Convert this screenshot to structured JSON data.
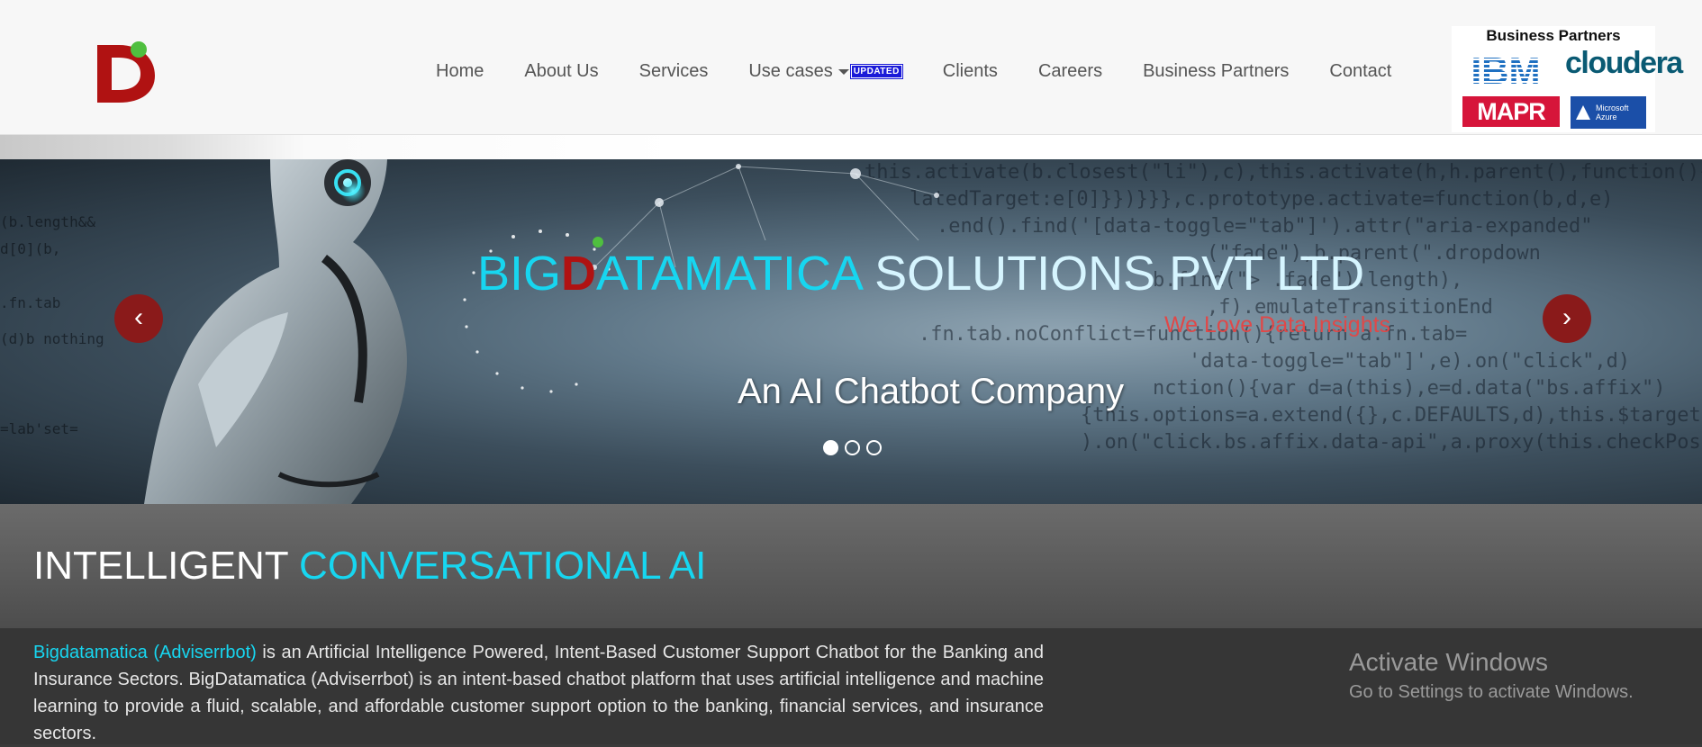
{
  "nav": {
    "items": [
      {
        "label": "Home"
      },
      {
        "label": "About Us"
      },
      {
        "label": "Services"
      },
      {
        "label": "Use cases",
        "badge": "UPDATED"
      },
      {
        "label": "Clients"
      },
      {
        "label": "Careers"
      },
      {
        "label": "Business Partners"
      },
      {
        "label": "Contact"
      }
    ]
  },
  "partners": {
    "title": "Business Partners",
    "logos": {
      "ibm": "IBM",
      "cloudera": "cloudera",
      "mapr": "MAPR",
      "azure_line1": "Microsoft",
      "azure_line2": "Azure"
    }
  },
  "hero": {
    "title_part1": "BIG",
    "title_d": "D",
    "title_part2": "ATAMATICA",
    "title_part3": " SOLUTIONS PVT LTD",
    "tagline": "We Love Data Insights",
    "subtitle": "An AI Chatbot Company",
    "prev_label": "‹",
    "next_label": "›",
    "slide_count": 3,
    "active_slide": 1
  },
  "intro": {
    "title_white": "INTELLIGENT ",
    "title_cyan": "CONVERSATIONAL AI",
    "para_highlight": "Bigdatamatica (Adviserrbot)",
    "para_rest": " is an Artificial Intelligence Powered, Intent-Based Customer Support Chatbot for the Banking and Insurance Sectors. BigDatamatica (Adviserrbot) is an intent-based chatbot platform that uses artificial intelligence and machine learning to provide a fluid, scalable, and affordable customer support option to the banking, financial services, and insurance sectors."
  },
  "watermark": {
    "line1": "Activate Windows",
    "line2": "Go to Settings to activate Windows."
  },
  "colors": {
    "accent": "#17d6f0",
    "brand_red": "#b01212",
    "updated_badge": "#1a1ad8"
  }
}
